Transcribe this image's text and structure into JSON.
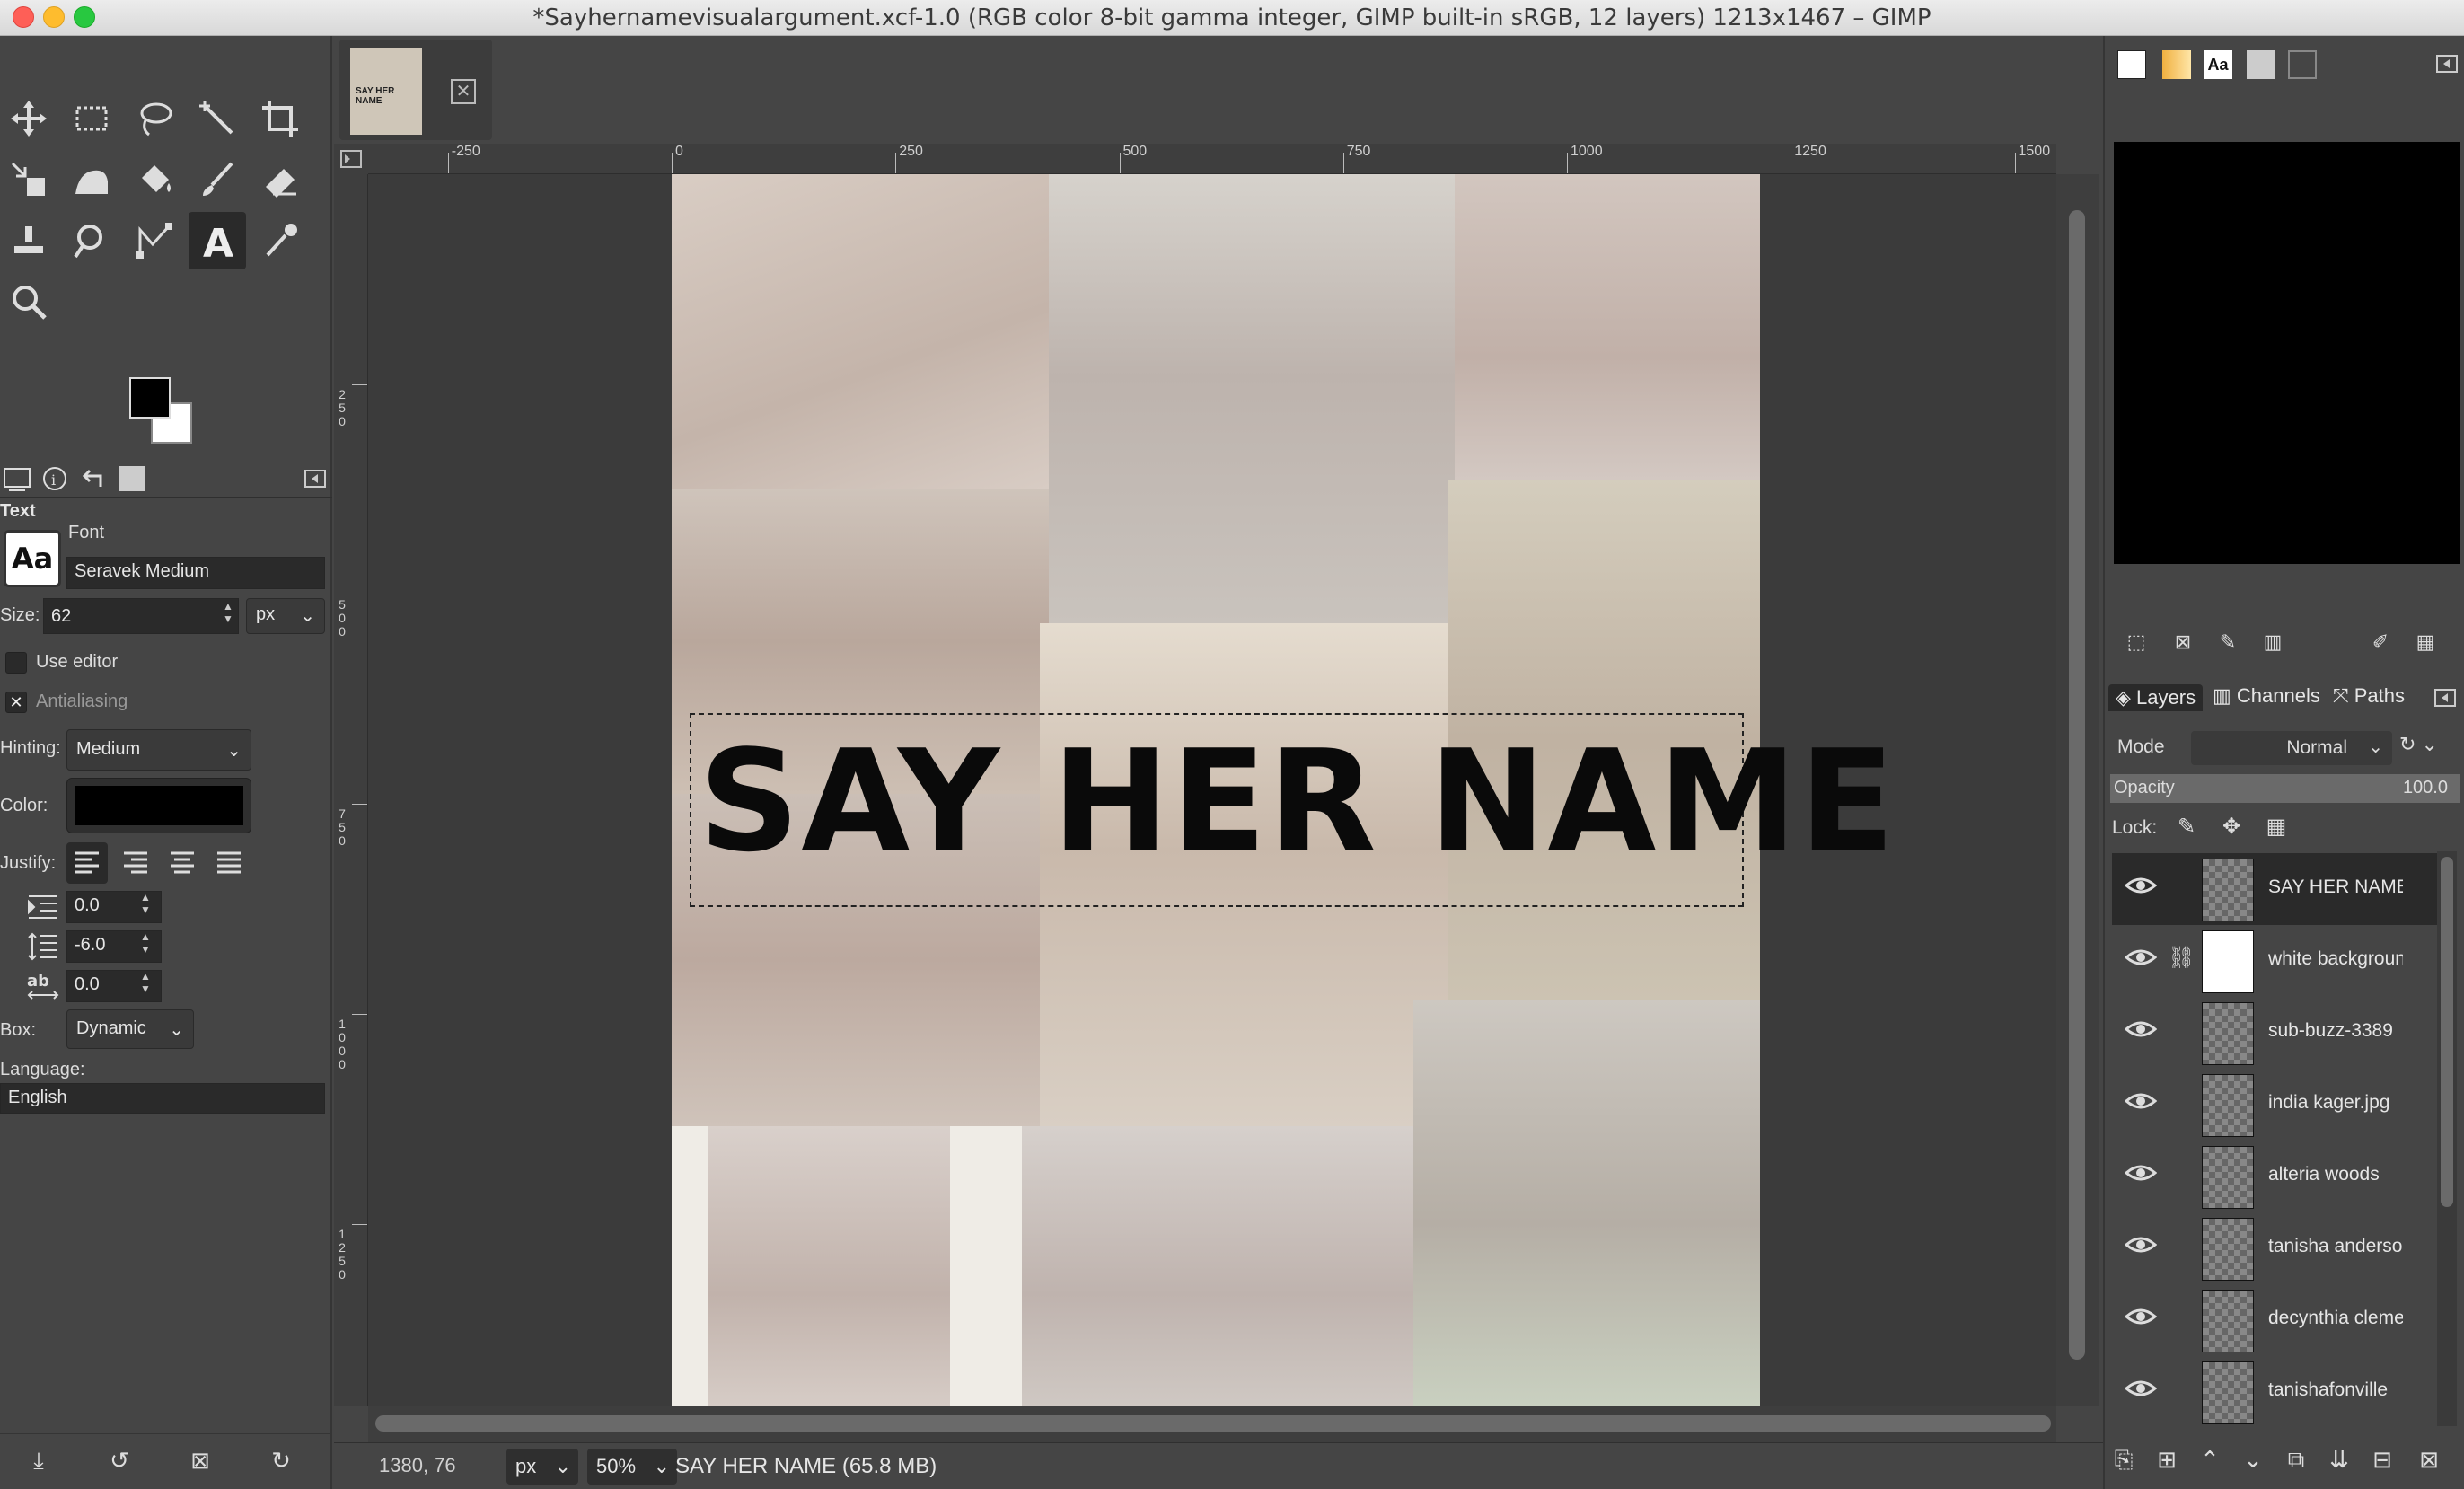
{
  "window": {
    "title": "*Sayhernamevisualargument.xcf-1.0 (RGB color 8-bit gamma integer, GIMP built-in sRGB, 12 layers) 1213x1467 – GIMP"
  },
  "toolbox": {
    "tools": [
      "move-tool",
      "rect-select-tool",
      "free-select-tool",
      "fuzzy-select-tool",
      "crop-tool",
      "transform-tool",
      "warp-tool",
      "bucket-fill-tool",
      "paintbrush-tool",
      "eraser-tool",
      "clone-tool",
      "smudge-tool",
      "paths-tool",
      "text-tool",
      "color-picker-tool",
      "zoom-tool"
    ],
    "fg_color": "#000000",
    "bg_color": "#ffffff"
  },
  "tool_options": {
    "title": "Text",
    "font_label": "Font",
    "font_value": "Seravek Medium",
    "font_preview": "Aa",
    "size_label": "Size:",
    "size_value": "62",
    "size_unit": "px",
    "use_editor": "Use editor",
    "antialiasing": "Antialiasing",
    "hinting_label": "Hinting:",
    "hinting_value": "Medium",
    "color_label": "Color:",
    "color_value": "#000000",
    "justify_label": "Justify:",
    "indent": "0.0",
    "line_spacing": "-6.0",
    "letter_spacing": "0.0",
    "box_label": "Box:",
    "box_value": "Dynamic",
    "language_label": "Language:",
    "language_value": "English"
  },
  "image_tab": {
    "thumb_text": "SAY HER NAME"
  },
  "rulers": {
    "top": [
      "-250",
      "0",
      "250",
      "500",
      "750",
      "1000",
      "1250",
      "1500"
    ],
    "left": [
      "250",
      "500",
      "750",
      "1000",
      "1250"
    ]
  },
  "canvas": {
    "text": "SAY HER NAME"
  },
  "status": {
    "coords": "1380, 76",
    "unit": "px",
    "zoom": "50%",
    "message": "SAY HER NAME (65.8 MB)"
  },
  "layers_panel": {
    "tabs": [
      "Layers",
      "Channels",
      "Paths"
    ],
    "mode_label": "Mode",
    "mode_value": "Normal",
    "opacity_label": "Opacity",
    "opacity_value": "100.0",
    "lock_label": "Lock:",
    "layers": [
      {
        "name": "SAY HER NAME",
        "selected": true
      },
      {
        "name": "white background",
        "selected": false
      },
      {
        "name": "sub-buzz-3389",
        "selected": false
      },
      {
        "name": "india kager.jpg",
        "selected": false
      },
      {
        "name": "alteria woods",
        "selected": false
      },
      {
        "name": "tanisha anderson",
        "selected": false
      },
      {
        "name": "decynthia clements",
        "selected": false
      },
      {
        "name": "tanishafonville",
        "selected": false
      }
    ]
  }
}
